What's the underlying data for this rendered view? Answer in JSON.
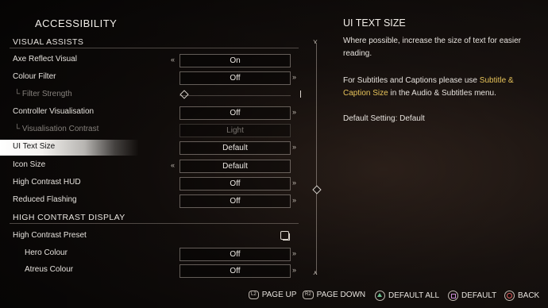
{
  "header": {
    "title": "ACCESSIBILITY"
  },
  "sections": {
    "visual_assists": "VISUAL ASSISTS",
    "high_contrast_display": "HIGH CONTRAST DISPLAY"
  },
  "rows": {
    "axe_reflect": {
      "label": "Axe Reflect Visual",
      "value": "On"
    },
    "colour_filter": {
      "label": "Colour Filter",
      "value": "Off"
    },
    "filter_strength": {
      "label": "└ Filter Strength",
      "level": 0
    },
    "controller_vis": {
      "label": "Controller Visualisation",
      "value": "Off"
    },
    "vis_contrast": {
      "label": "└ Visualisation Contrast",
      "value": "Light"
    },
    "ui_text_size": {
      "label": "UI Text Size",
      "value": "Default"
    },
    "icon_size": {
      "label": "Icon Size",
      "value": "Default"
    },
    "hc_hud": {
      "label": "High Contrast HUD",
      "value": "Off"
    },
    "reduced_flashing": {
      "label": "Reduced Flashing",
      "value": "Off"
    },
    "hc_preset": {
      "label": "High Contrast Preset"
    },
    "hero_colour": {
      "label": "Hero Colour",
      "value": "Off"
    },
    "atreus_colour": {
      "label": "Atreus Colour",
      "value": "Off"
    }
  },
  "info": {
    "title": "UI TEXT SIZE",
    "p1": "Where possible, increase the size of text for easier reading.",
    "p2_pre": "For Subtitles and Captions please use ",
    "p2_link": "Subtitle & Caption Size",
    "p2_post": " in the Audio & Subtitles menu.",
    "p3": "Default Setting: Default"
  },
  "footer": {
    "l2": "L2",
    "page_up": "PAGE UP",
    "r2": "R2",
    "page_down": "PAGE DOWN",
    "default_all": "DEFAULT ALL",
    "default": "DEFAULT",
    "back": "BACK"
  },
  "colors": {
    "highlight": "#e8c45a",
    "triangle": "#6ac08f",
    "square": "#c88bd6",
    "circle": "#e06060"
  },
  "icons": {
    "arrow_left": "«",
    "arrow_right": "»",
    "scroll_end": "⋎"
  }
}
